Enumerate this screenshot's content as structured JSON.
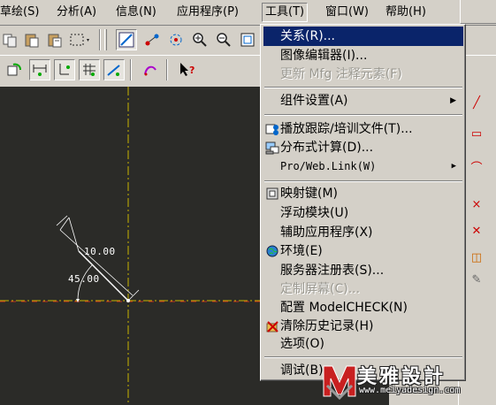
{
  "menubar": {
    "items": [
      {
        "label": "草绘(S)"
      },
      {
        "label": "分析(A)"
      },
      {
        "label": "信息(N)"
      },
      {
        "label": "应用程序(P)"
      },
      {
        "label": "工具(T)"
      },
      {
        "label": "窗口(W)"
      },
      {
        "label": "帮助(H)"
      }
    ]
  },
  "canvas": {
    "dimension_length": "10.00",
    "dimension_angle": "45.00"
  },
  "tools_menu": {
    "items": [
      {
        "label": "关系(R)...",
        "state": "highlighted"
      },
      {
        "label": "图像编辑器(I)...",
        "state": "enabled"
      },
      {
        "label": "更新 Mfg 注释元素(F)",
        "state": "disabled"
      },
      {
        "label": "组件设置(A)",
        "state": "submenu"
      },
      {
        "label": "播放跟踪/培训文件(T)...",
        "state": "enabled",
        "icon": "trail-file-icon"
      },
      {
        "label": "分布式计算(D)...",
        "state": "enabled",
        "icon": "distributed-computing-icon"
      },
      {
        "label": "Pro/Web.Link(W)",
        "state": "submenu"
      },
      {
        "label": "映射键(M)",
        "state": "enabled",
        "icon": "mapkey-icon"
      },
      {
        "label": "浮动模块(U)",
        "state": "enabled"
      },
      {
        "label": "辅助应用程序(X)",
        "state": "enabled"
      },
      {
        "label": "环境(E)",
        "state": "enabled",
        "icon": "globe-icon"
      },
      {
        "label": "服务器注册表(S)...",
        "state": "enabled"
      },
      {
        "label": "定制屏幕(C)...",
        "state": "disabled"
      },
      {
        "label": "配置 ModelCHECK(N)",
        "state": "enabled"
      },
      {
        "label": "清除历史记录(H)",
        "state": "enabled",
        "icon": "clear-history-icon"
      },
      {
        "label": "选项(O)",
        "state": "enabled"
      },
      {
        "label": "调试(B)",
        "state": "enabled"
      }
    ]
  },
  "logo": {
    "brand": "美雅設計",
    "url": "www.meiyadesign.com"
  },
  "colors": {
    "menu_highlight": "#0a246a",
    "canvas_bg": "#2b2b28",
    "sketch_line": "#ffffff",
    "centerline": "#c8b400",
    "axis_red": "#c03020"
  }
}
